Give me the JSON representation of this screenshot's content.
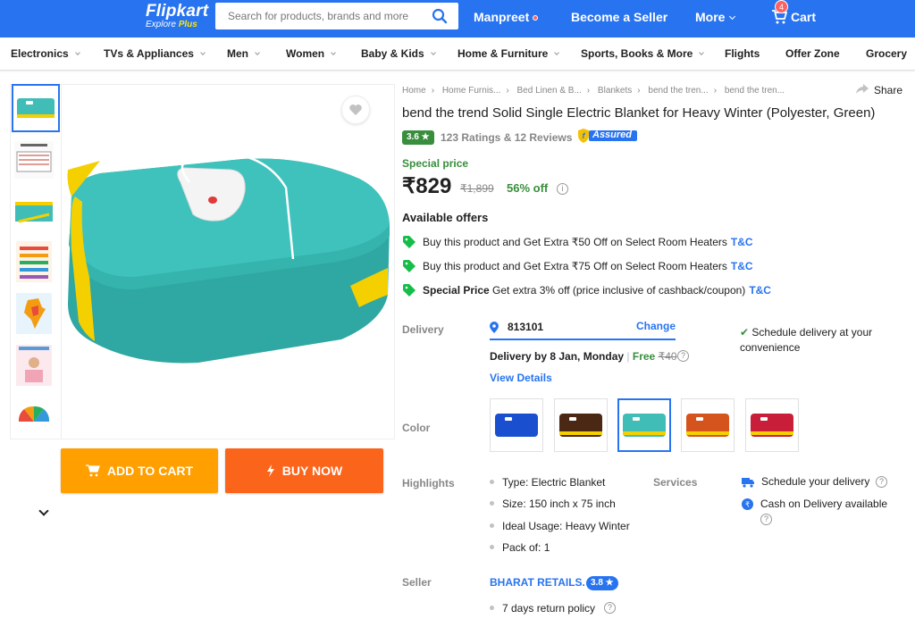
{
  "header": {
    "logo": "Flipkart",
    "logo_sub": "Explore",
    "logo_plus": "Plus",
    "search_placeholder": "Search for products, brands and more",
    "user": "Manpreet",
    "become_seller": "Become a Seller",
    "more": "More",
    "cart_label": "Cart",
    "cart_count": "4"
  },
  "categories": [
    "Electronics",
    "TVs & Appliances",
    "Men",
    "Women",
    "Baby & Kids",
    "Home & Furniture",
    "Sports, Books & More",
    "Flights",
    "Offer Zone",
    "Grocery"
  ],
  "gallery": {
    "add_to_cart": "ADD TO CART",
    "buy_now": "BUY NOW"
  },
  "breadcrumbs": [
    "Home",
    "Home Furnis...",
    "Bed Linen & B...",
    "Blankets",
    "bend the tren...",
    "bend the tren..."
  ],
  "share": "Share",
  "product": {
    "title": "bend the trend Solid Single Electric Blanket for Heavy Winter  (Polyester, Green)",
    "rating": "3.6",
    "rating_count": "123 Ratings & 12 Reviews",
    "assured": "Assured",
    "special": "Special price",
    "price": "₹829",
    "mrp": "₹1,899",
    "discount": "56% off"
  },
  "offers": {
    "title": "Available offers",
    "items": [
      {
        "bold": "",
        "text": "Buy this product and Get Extra ₹50 Off on Select Room Heaters",
        "tc": "T&C"
      },
      {
        "bold": "",
        "text": "Buy this product and Get Extra ₹75 Off on Select Room Heaters",
        "tc": "T&C"
      },
      {
        "bold": "Special Price",
        "text": " Get extra 3% off (price inclusive of cashback/coupon)",
        "tc": "T&C"
      }
    ]
  },
  "delivery": {
    "label": "Delivery",
    "pincode": "813101",
    "change": "Change",
    "line_prefix": "Delivery by 8 Jan, Monday",
    "sep": "|",
    "free": "Free",
    "fee": "₹40",
    "view_details": "View Details",
    "schedule": "Schedule delivery at your convenience"
  },
  "color": {
    "label": "Color",
    "swatches": [
      "#1a4fd0",
      "#4a2814",
      "#3fbdb6",
      "#d5541e",
      "#c81e3a"
    ]
  },
  "highlights": {
    "label": "Highlights",
    "items": [
      "Type: Electric Blanket",
      "Size: 150 inch x 75 inch",
      "Ideal Usage: Heavy Winter",
      "Pack of: 1"
    ]
  },
  "services": {
    "label": "Services",
    "items": [
      "Schedule your delivery",
      "Cash on Delivery available"
    ]
  },
  "seller": {
    "label": "Seller",
    "name": "BHARAT RETAILS.",
    "rating": "3.8",
    "return_policy": "7 days return policy"
  },
  "colors": {
    "brand": "#2874f0",
    "cart": "#ff9f00",
    "buy": "#fb641b",
    "green": "#388e3c"
  }
}
